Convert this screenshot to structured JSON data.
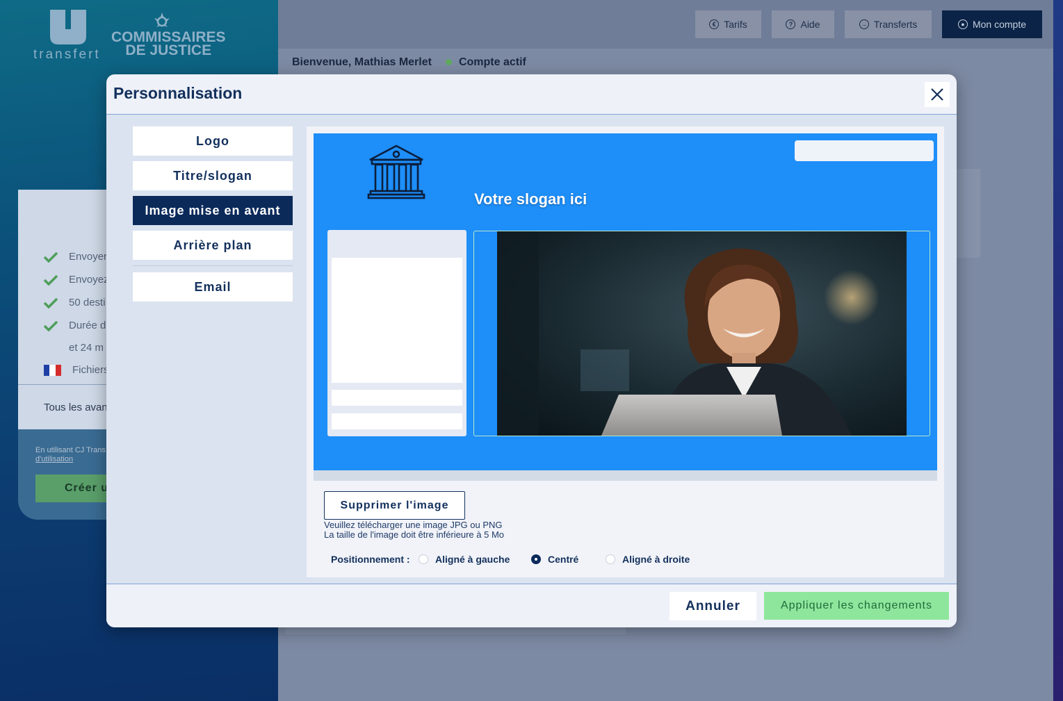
{
  "brand": {
    "logo_word": "transfert",
    "partner_line1": "COMMISSAIRES",
    "partner_line2": "DE JUSTICE"
  },
  "top_nav": {
    "tarifs": "Tarifs",
    "aide": "Aide",
    "transferts": "Transferts",
    "mon_compte": "Mon compte"
  },
  "welcome": {
    "greeting": "Bienvenue, Mathias Merlet",
    "status": "Compte actif",
    "status_color": "#5eaa5e"
  },
  "plan": {
    "features": [
      "Envoyer",
      "Envoyez",
      "50 desti",
      "Durée d",
      "et 24 m",
      "Fichiers"
    ],
    "footer": "Tous les avan"
  },
  "terms": {
    "line1": "En utilisant CJ Trans",
    "link": "d'utilisation",
    "create_button": "Créer u"
  },
  "modal": {
    "title": "Personnalisation",
    "nav": [
      "Logo",
      "Titre/slogan",
      "Image mise en avant",
      "Arrière plan",
      "Email"
    ],
    "active_nav": "Image mise en avant",
    "preview": {
      "slogan": "Votre slogan ici",
      "background_color": "#1e8ef8"
    },
    "remove_image": "Supprimer l'image",
    "hint_line1": "Veuillez télécharger une image JPG ou PNG",
    "hint_line2": "La taille de l'image doit être inférieure à 5 Mo",
    "positioning_label": "Positionnement :",
    "positions": [
      "Aligné à gauche",
      "Centré",
      "Aligné à droite"
    ],
    "selected_position": "Centré",
    "cancel": "Annuler",
    "apply": "Appliquer les changements",
    "apply_color": "#8ee69c"
  }
}
